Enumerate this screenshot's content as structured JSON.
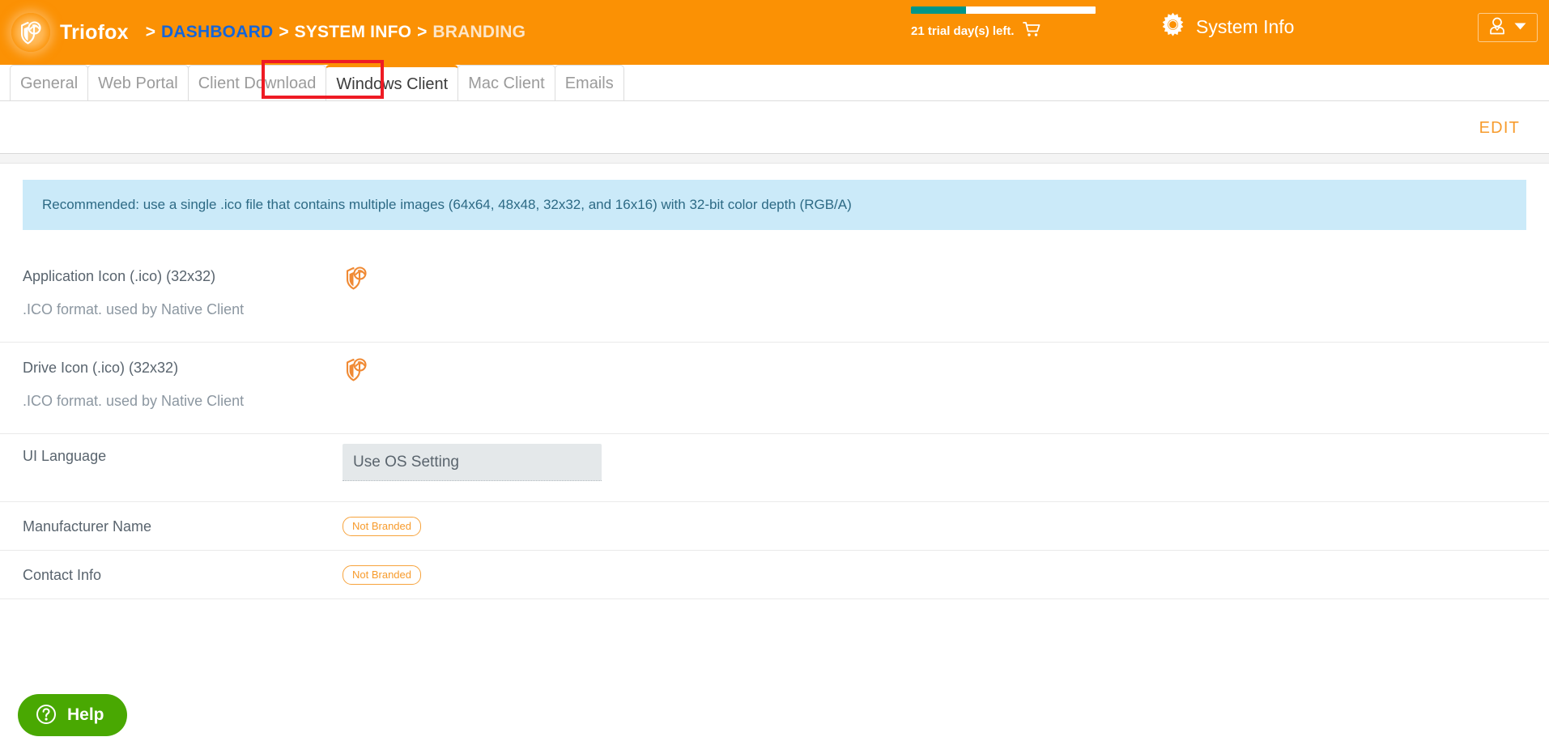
{
  "header": {
    "brand": "Triofox",
    "logo_icon": "triofox-shield-globe-logo",
    "breadcrumb": {
      "separator": ">",
      "items": [
        {
          "label": "DASHBOARD",
          "style": "link"
        },
        {
          "label": "SYSTEM INFO",
          "style": "plain"
        },
        {
          "label": "BRANDING",
          "style": "muted"
        }
      ]
    },
    "trial": {
      "text": "21 trial day(s) left.",
      "cart_icon": "shopping-cart-icon",
      "progress_percent": 30,
      "progress_fill_color": "#009688",
      "progress_track_color": "#ffffff"
    },
    "system_info": {
      "label": "System Info",
      "icon": "gear-icon"
    },
    "user_menu": {
      "avatar_icon": "user-avatar-icon",
      "caret_icon": "chevron-down-icon"
    },
    "background_color": "#fb9104"
  },
  "tabs": {
    "items": [
      {
        "label": "General",
        "active": false
      },
      {
        "label": "Web Portal",
        "active": false
      },
      {
        "label": "Client Download",
        "active": false
      },
      {
        "label": "Windows Client",
        "active": true
      },
      {
        "label": "Mac Client",
        "active": false
      },
      {
        "label": "Emails",
        "active": false
      }
    ],
    "highlight_color": "#ee1b24",
    "active_indicator_color": "#fb9104"
  },
  "actions": {
    "edit_label": "EDIT",
    "edit_color": "#f79b2c"
  },
  "banner": {
    "text": "Recommended: use a single .ico file that contains multiple images (64x64, 48x48, 32x32, and 16x16) with 32-bit color depth (RGB/A)",
    "background_color": "#cbeaf9",
    "text_color": "#2d6a85"
  },
  "form": {
    "rows": [
      {
        "label": "Application Icon (.ico) (32x32)",
        "sublabel": ".ICO format. used by Native Client",
        "value_type": "icon",
        "icon": "triofox-shield-globe-icon"
      },
      {
        "label": "Drive Icon (.ico) (32x32)",
        "sublabel": ".ICO format. used by Native Client",
        "value_type": "icon",
        "icon": "triofox-shield-globe-icon"
      },
      {
        "label": "UI Language",
        "sublabel": "",
        "value_type": "input",
        "value": "Use OS Setting"
      },
      {
        "label": "Manufacturer Name",
        "sublabel": "",
        "value_type": "badge",
        "value": "Not Branded"
      },
      {
        "label": "Contact Info",
        "sublabel": "",
        "value_type": "badge",
        "value": "Not Branded"
      }
    ]
  },
  "help": {
    "label": "Help",
    "icon": "question-mark-circle-icon",
    "background_color": "#49a802"
  }
}
